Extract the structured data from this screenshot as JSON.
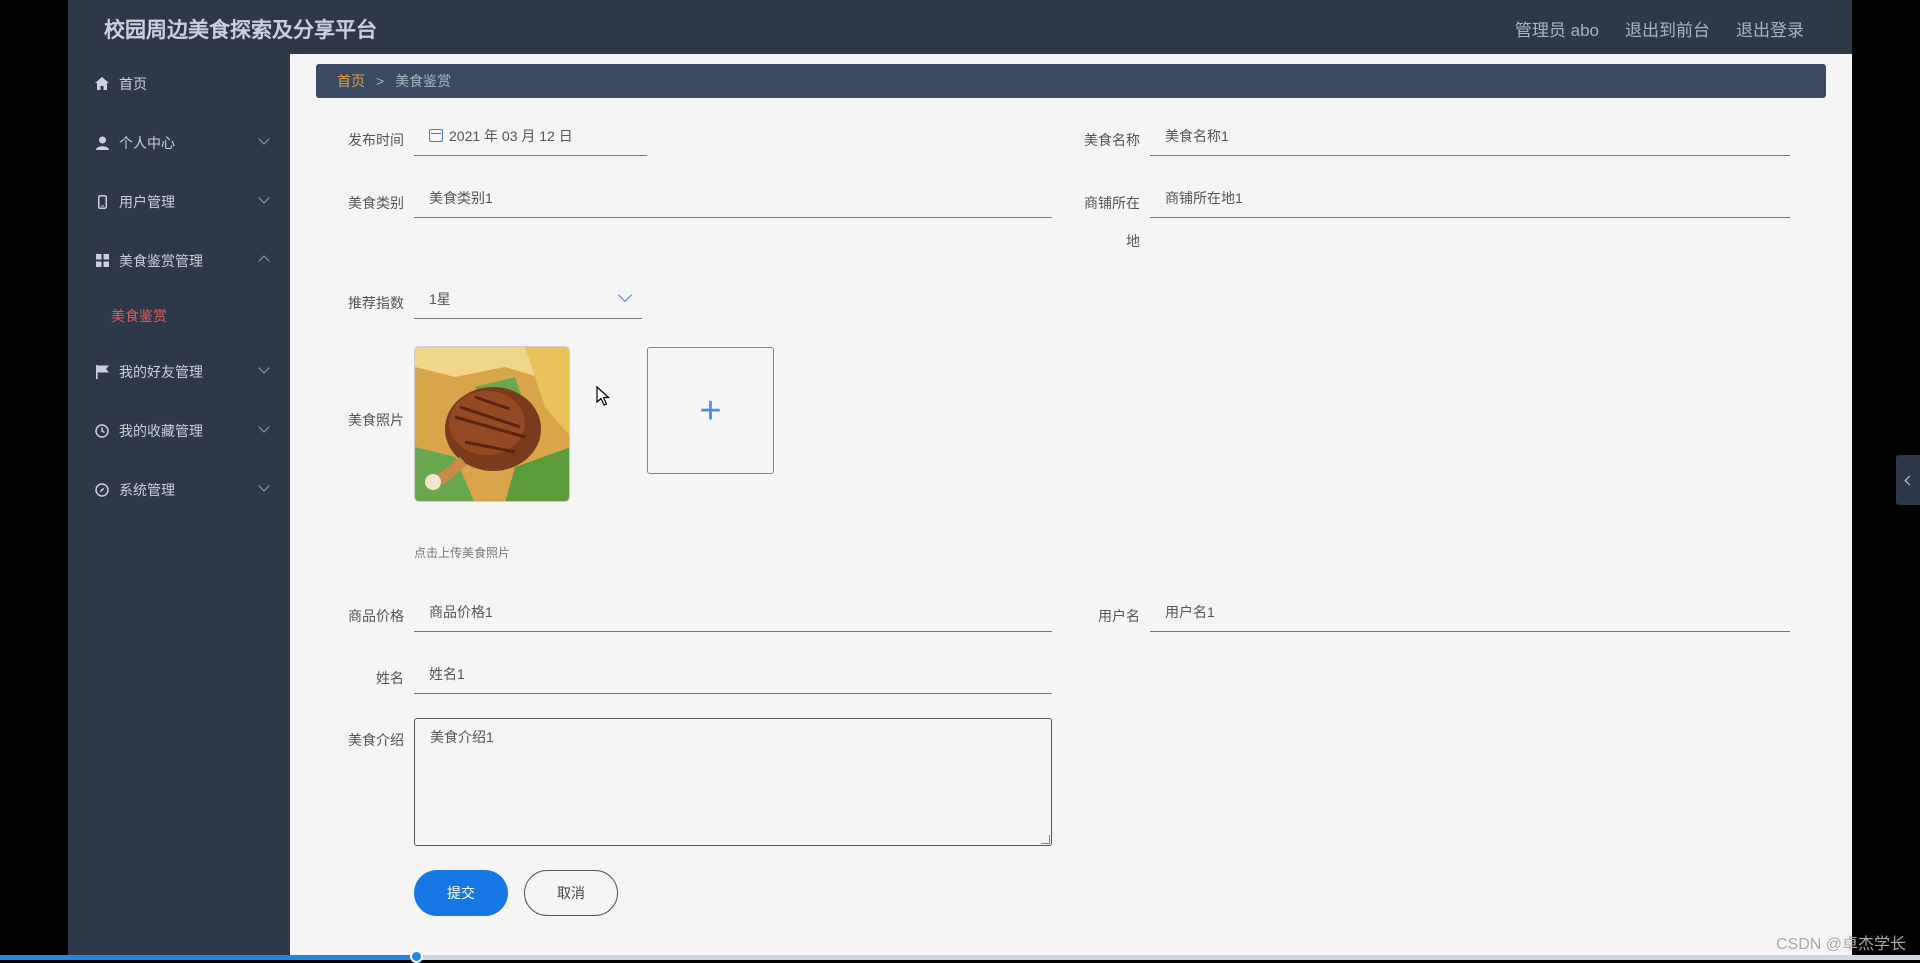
{
  "header": {
    "title": "校园周边美食探索及分享平台",
    "links": [
      "管理员 abo",
      "退出到前台",
      "退出登录"
    ]
  },
  "sidebar": {
    "items": [
      {
        "label": "首页",
        "icon": "home-icon"
      },
      {
        "label": "个人中心",
        "icon": "user-icon"
      },
      {
        "label": "用户管理",
        "icon": "phone-icon"
      },
      {
        "label": "美食鉴赏管理",
        "icon": "grid-icon"
      },
      {
        "label": "我的好友管理",
        "icon": "flag-icon"
      },
      {
        "label": "我的收藏管理",
        "icon": "clock-icon"
      },
      {
        "label": "系统管理",
        "icon": "compass-icon"
      }
    ],
    "submenu": {
      "label": "美食鉴赏"
    }
  },
  "breadcrumb": {
    "home": "首页",
    "separator": ">",
    "current": "美食鉴赏"
  },
  "form": {
    "publish_time": {
      "label": "发布时间",
      "value": "2021 年 03 月 12 日"
    },
    "food_name": {
      "label": "美食名称",
      "value": "美食名称1"
    },
    "food_category": {
      "label": "美食类别",
      "value": "美食类别1"
    },
    "shop_location": {
      "label_line1": "商铺所在",
      "label_line2": "地",
      "value": "商铺所在地1"
    },
    "rating": {
      "label": "推荐指数",
      "value": "1星"
    },
    "photo": {
      "label": "美食照片",
      "hint": "点击上传美食照片",
      "upload_symbol": "+"
    },
    "price": {
      "label": "商品价格",
      "value": "商品价格1"
    },
    "username": {
      "label": "用户名",
      "value": "用户名1"
    },
    "name": {
      "label": "姓名",
      "value": "姓名1"
    },
    "intro": {
      "label": "美食介绍",
      "value": "美食介绍1"
    },
    "submit_label": "提交",
    "cancel_label": "取消"
  },
  "progress": {
    "fraction": 0.217
  },
  "watermark": "CSDN @卓杰学长",
  "colors": {
    "sidebar_bg": "#2e3849",
    "accent_blue": "#1677e5",
    "active_submenu": "#e05a5a",
    "breadcrumb_home": "#e0a03c"
  }
}
